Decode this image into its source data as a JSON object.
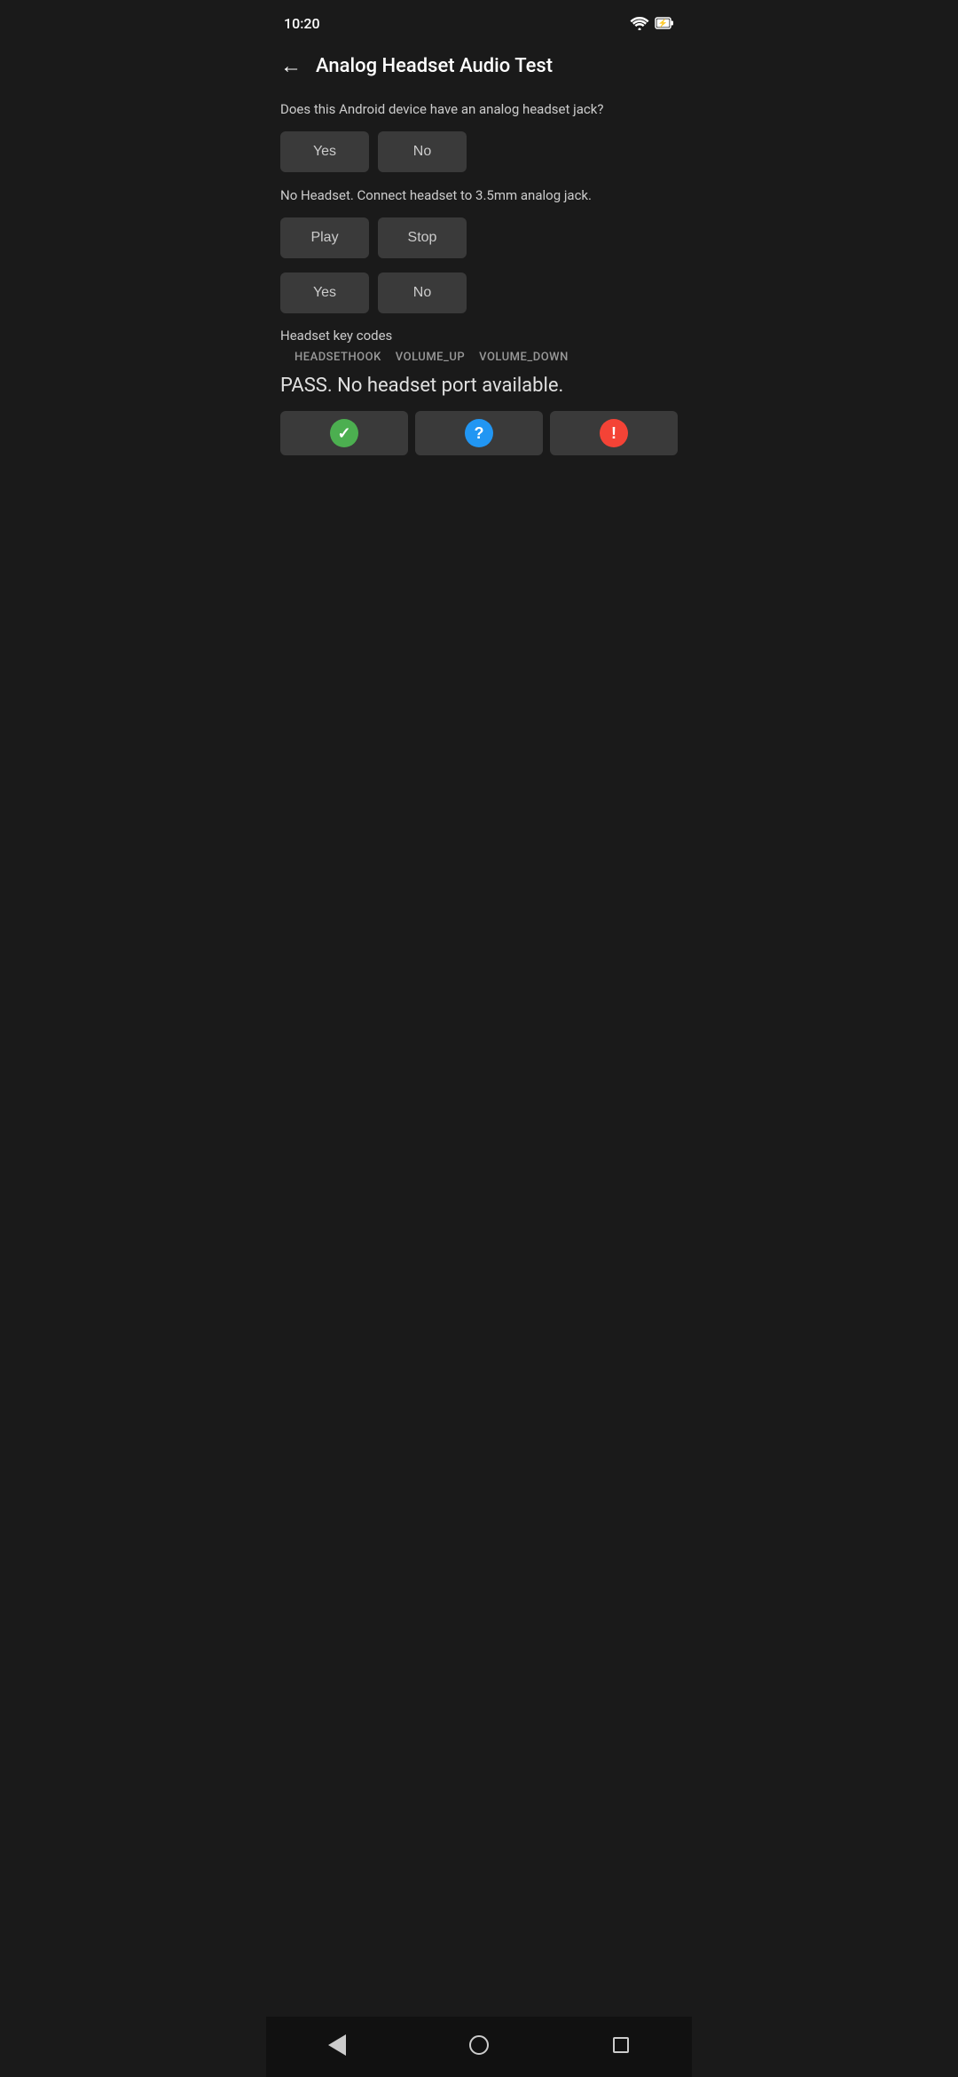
{
  "statusBar": {
    "time": "10:20",
    "icons": [
      "wifi",
      "battery-charging"
    ]
  },
  "header": {
    "backLabel": "←",
    "title": "Analog Headset Audio Test"
  },
  "section1": {
    "question": "Does this Android device have an analog headset jack?",
    "yesLabel": "Yes",
    "noLabel": "No"
  },
  "section2": {
    "info": "No Headset. Connect headset to 3.5mm analog jack.",
    "playLabel": "Play",
    "stopLabel": "Stop"
  },
  "section3": {
    "yesLabel": "Yes",
    "noLabel": "No"
  },
  "section4": {
    "label": "Headset key codes",
    "keyCodes": [
      "HEADSETHOOK",
      "VOLUME_UP",
      "VOLUME_DOWN"
    ],
    "passText": "PASS. No headset port available."
  },
  "actionButtons": {
    "passIcon": "✓",
    "unknownIcon": "?",
    "failIcon": "!"
  },
  "navBar": {
    "back": "◀",
    "home": "○",
    "recent": "□"
  }
}
